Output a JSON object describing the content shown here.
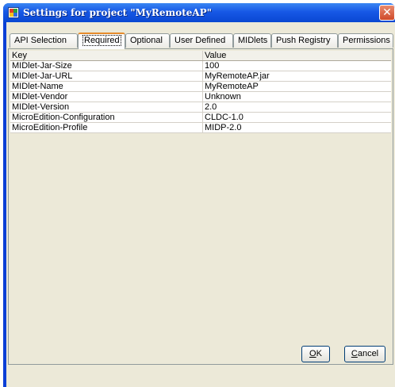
{
  "window": {
    "title": "Settings for project \"MyRemoteAP\"",
    "close_glyph": "✕"
  },
  "tabs": [
    {
      "label": "API Selection",
      "active": false
    },
    {
      "label": "Required",
      "active": true
    },
    {
      "label": "Optional",
      "active": false
    },
    {
      "label": "User Defined",
      "active": false
    },
    {
      "label": "MIDlets",
      "active": false
    },
    {
      "label": "Push Registry",
      "active": false
    },
    {
      "label": "Permissions",
      "active": false
    }
  ],
  "table": {
    "headers": {
      "key": "Key",
      "value": "Value"
    },
    "rows": [
      {
        "key": "MIDlet-Jar-Size",
        "value": "100"
      },
      {
        "key": "MIDlet-Jar-URL",
        "value": "MyRemoteAP.jar"
      },
      {
        "key": "MIDlet-Name",
        "value": "MyRemoteAP"
      },
      {
        "key": "MIDlet-Vendor",
        "value": "Unknown"
      },
      {
        "key": "MIDlet-Version",
        "value": "2.0"
      },
      {
        "key": "MicroEdition-Configuration",
        "value": "CLDC-1.0"
      },
      {
        "key": "MicroEdition-Profile",
        "value": "MIDP-2.0"
      }
    ]
  },
  "buttons": {
    "ok_mnemonic": "O",
    "ok_rest": "K",
    "cancel_mnemonic": "C",
    "cancel_rest": "ancel"
  }
}
